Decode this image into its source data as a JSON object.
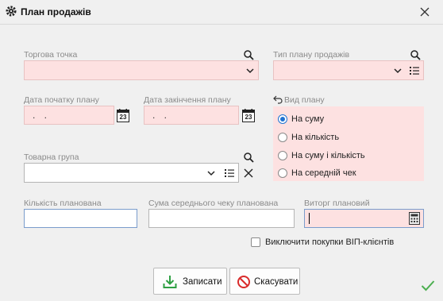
{
  "window": {
    "title": "План продажів"
  },
  "fields": {
    "outlet_label": "Торгова точка",
    "plan_type_label": "Тип плану продажів",
    "start_date_label": "Дата початку плану",
    "start_date_value": ". .",
    "end_date_label": "Дата закінчення плану",
    "end_date_value": ". .",
    "product_group_label": "Товарна група",
    "planned_qty_label": "Кількість планована",
    "avg_check_label": "Сума середнього чеку планована",
    "planned_revenue_label": "Виторг плановий"
  },
  "plan_kind": {
    "label": "Вид плану",
    "options": [
      "На суму",
      "На кількість",
      "На суму і кількість",
      "На середній чек"
    ],
    "selected": "На суму"
  },
  "exclude_vip": {
    "label": "Виключити покупки ВІП-клієнтів",
    "checked": false
  },
  "calendar_day": "23",
  "buttons": {
    "save": "Записати",
    "cancel": "Скасувати"
  },
  "colors": {
    "required_bg": "#fde1e1",
    "accent": "#1f73d2",
    "save_green": "#2ea043",
    "cancel_red": "#d92b2b"
  }
}
